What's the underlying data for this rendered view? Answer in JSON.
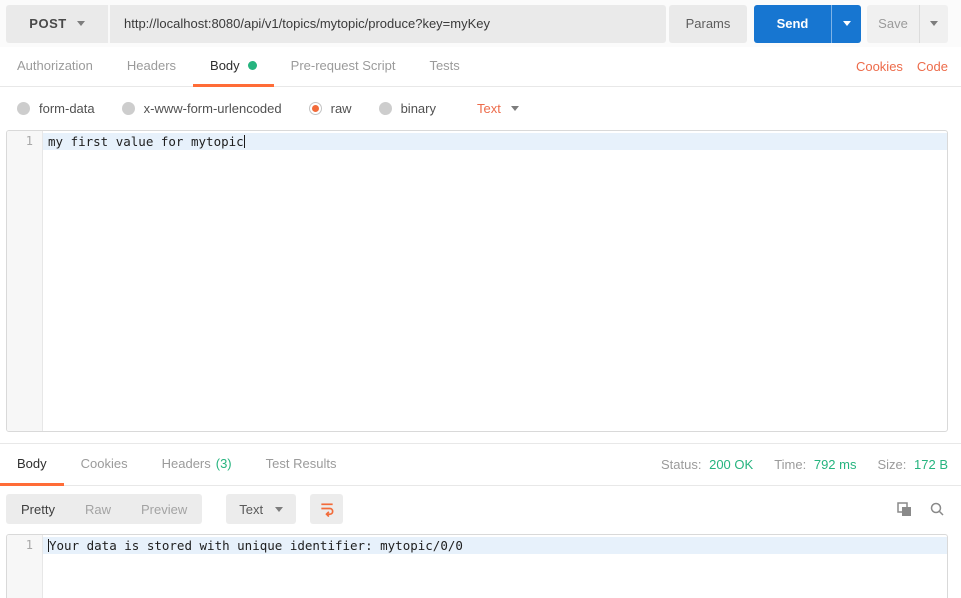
{
  "request_bar": {
    "method": "POST",
    "url": "http://localhost:8080/api/v1/topics/mytopic/produce?key=myKey",
    "params_label": "Params",
    "send_label": "Send",
    "save_label": "Save"
  },
  "request_tabs": {
    "items": [
      {
        "label": "Authorization"
      },
      {
        "label": "Headers"
      },
      {
        "label": "Body",
        "active": true,
        "modified_dot": true
      },
      {
        "label": "Pre-request Script"
      },
      {
        "label": "Tests"
      }
    ],
    "cookies_link": "Cookies",
    "code_link": "Code"
  },
  "body_type_bar": {
    "options": [
      {
        "label": "form-data",
        "selected": false
      },
      {
        "label": "x-www-form-urlencoded",
        "selected": false
      },
      {
        "label": "raw",
        "selected": true
      },
      {
        "label": "binary",
        "selected": false
      }
    ],
    "format_selector": "Text"
  },
  "request_editor": {
    "line_number": "1",
    "content": "my first value for mytopic"
  },
  "response_section": {
    "tabs": [
      {
        "label": "Body",
        "active": true
      },
      {
        "label": "Cookies"
      },
      {
        "label": "Headers",
        "count": "(3)"
      },
      {
        "label": "Test Results"
      }
    ],
    "meta": {
      "status_label": "Status:",
      "status_value": "200 OK",
      "time_label": "Time:",
      "time_value": "792 ms",
      "size_label": "Size:",
      "size_value": "172 B"
    },
    "view_toolbar": {
      "views": [
        "Pretty",
        "Raw",
        "Preview"
      ],
      "active_view": "Pretty",
      "format_selector": "Text"
    },
    "editor": {
      "line_number": "1",
      "content": "Your data is stored with unique identifier: mytopic/0/0"
    }
  },
  "icons": {
    "chevron-down": "▾",
    "body-modified-dot": "●",
    "wrap-text": "↩",
    "copy": "⧉",
    "search": "⌕"
  },
  "colors": {
    "accent_orange": "#ff6c37",
    "link_orange": "#ed6b4a",
    "send_blue": "#1776d1",
    "status_green": "#26b47f",
    "active_line_blue": "#e7f1fb"
  }
}
